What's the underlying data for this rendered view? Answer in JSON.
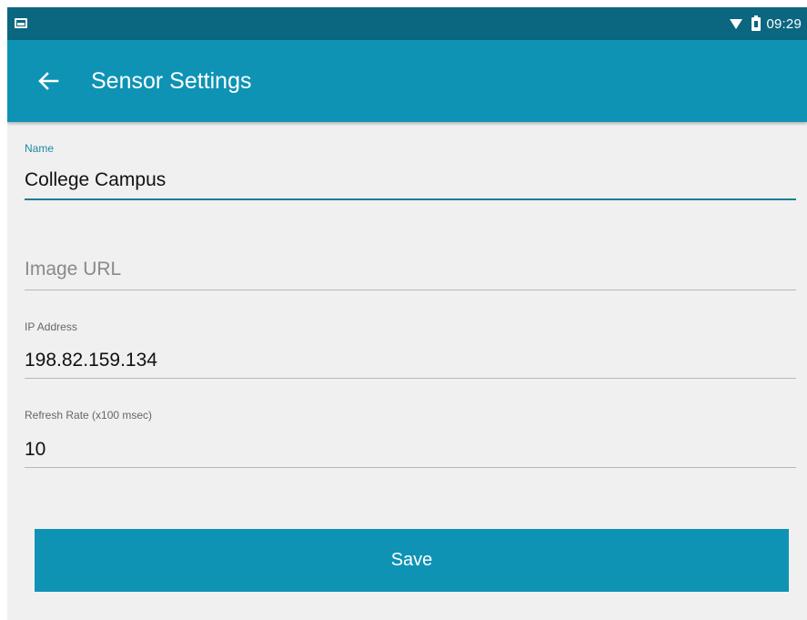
{
  "status_bar": {
    "time": "09:29",
    "icons": [
      "notification-icon",
      "wifi-icon",
      "battery-icon"
    ]
  },
  "app_bar": {
    "back_icon": "arrow-back-icon",
    "title": "Sensor Settings"
  },
  "form": {
    "name": {
      "label": "Name",
      "value": "College Campus"
    },
    "image_url": {
      "label": "Image URL",
      "placeholder": "Image URL",
      "value": ""
    },
    "ip_address": {
      "label": "IP Address",
      "value": "198.82.159.134"
    },
    "refresh_rate": {
      "label": "Refresh Rate (x100 msec)",
      "value": "10"
    }
  },
  "actions": {
    "save_label": "Save"
  },
  "colors": {
    "status_bar": "#0b6680",
    "app_bar": "#0e93b5",
    "background": "#f0f0f0",
    "accent": "#1b7f96",
    "button": "#0e93b5"
  }
}
